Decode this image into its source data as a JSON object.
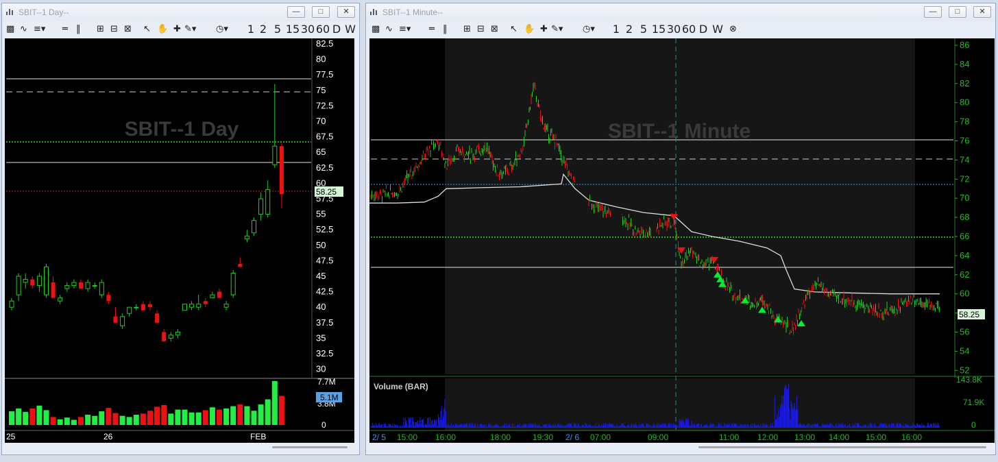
{
  "left_window": {
    "title": "SBIT--1 Day--",
    "toolbar": {
      "periods": [
        "1",
        "2",
        "5",
        "15",
        "30",
        "60",
        "D",
        "W"
      ]
    },
    "watermark": "SBIT--1 Day",
    "price_axis_labels": [
      "82.5",
      "80",
      "77.5",
      "75",
      "72.5",
      "70",
      "67.5",
      "65",
      "62.5",
      "60",
      "57.5",
      "55",
      "52.5",
      "50",
      "47.5",
      "45",
      "42.5",
      "40",
      "37.5",
      "35",
      "32.5",
      "30"
    ],
    "last_price": "58.25",
    "volume_axis_labels": [
      "7.7M",
      "3.8M",
      "0"
    ],
    "volume_last": "5.1M",
    "date_labels": [
      "25",
      "26",
      "FEB"
    ]
  },
  "right_window": {
    "title": "SBIT--1 Minute--",
    "toolbar": {
      "periods": [
        "1",
        "2",
        "5",
        "15",
        "30",
        "60",
        "D",
        "W"
      ]
    },
    "watermark": "SBIT--1 Minute",
    "price_axis_labels": [
      "86",
      "84",
      "82",
      "80",
      "78",
      "76",
      "74",
      "72",
      "70",
      "68",
      "66",
      "64",
      "62",
      "60",
      "58",
      "56",
      "54",
      "52"
    ],
    "last_price": "58.25",
    "volume_title": "Volume (BAR)",
    "volume_axis_labels": [
      "143.8K",
      "71.9K",
      "0"
    ],
    "time_labels": [
      "2/ 5",
      "15:00",
      "16:00",
      "18:00",
      "19:30",
      "2/ 6",
      "07:00",
      "09:00",
      "11:00",
      "12:00",
      "13:00",
      "14:00",
      "15:00",
      "16:00"
    ]
  },
  "colors": {
    "up_candle": "#22cc22",
    "down_candle": "#ee1111",
    "price_axis_right": "#22bb22",
    "buy_marker": "#00ee33",
    "sell_marker": "#ee1111",
    "vwap": "#dddddd"
  },
  "icons": [
    "chart-icon",
    "minimize-icon",
    "maximize-icon",
    "close-icon",
    "crosshair-icon",
    "pencil-icon",
    "clock-icon",
    "hand-icon",
    "zoom-icon"
  ]
}
